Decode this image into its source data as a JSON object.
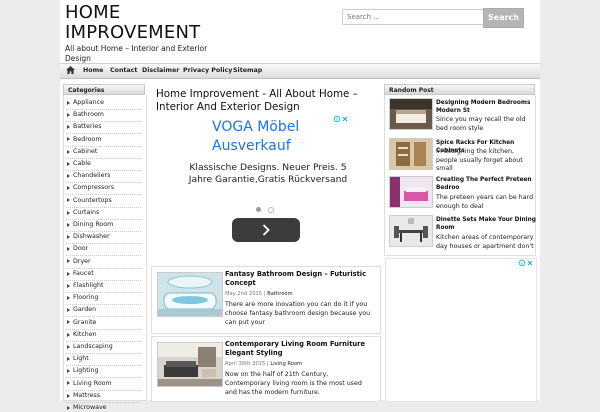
{
  "site": {
    "title_line1": "HOME",
    "title_line2": "IMPROVEMENT",
    "tagline": "All about Home – Interior and Exterior Design"
  },
  "search": {
    "placeholder": "Search ...",
    "button_label": "Search"
  },
  "nav": {
    "items": [
      "Home",
      "Contact",
      "Disclaimer",
      "Privacy Policy",
      "Sitemap"
    ]
  },
  "categories": {
    "heading": "Categories",
    "items": [
      "Appliance",
      "Bathroom",
      "Batteries",
      "Bedroom",
      "Cabinet",
      "Cable",
      "Chandeliers",
      "Compressors",
      "Countertops",
      "Curtains",
      "Dining Room",
      "Dishwasher",
      "Door",
      "Dryer",
      "Faucet",
      "Flashlight",
      "Flooring",
      "Garden",
      "Granite",
      "Kitchen",
      "Landscaping",
      "Light",
      "Lighting",
      "Living Room",
      "Mattress",
      "Microwave"
    ]
  },
  "main": {
    "title": "Home Improvement - All About Home – Interior And Exterior Design"
  },
  "ad": {
    "title": "VOGA Möbel Ausverkauf",
    "text": "Klassische Designs. Neuer Preis. 5 Jahre Garantie,Gratis Rückversand"
  },
  "posts": [
    {
      "title": "Fantasy Bathroom Design – Futuristic Concept",
      "date": "May 2nd 2015",
      "category": "Bathroom",
      "excerpt": "There are more inovation you can do it if you choose fantasy bathroom design because you can put your"
    },
    {
      "title": "Contemporary Living Room Furniture Elegant Styling",
      "date": "April 30th 2015",
      "category": "Living Room",
      "excerpt": "Now on the half of 21th Century, Contemporary living room is the most used and has the modern furniture."
    }
  ],
  "random_posts": {
    "heading": "Random Post",
    "items": [
      {
        "title": "Designing Modern Bedrooms Modern St",
        "excerpt": "Since you may recall the old bed room style"
      },
      {
        "title": "Spice Racks For Kitchen Cabinets",
        "excerpt": "In designing the kitchen, people usually forget about small"
      },
      {
        "title": "Creating The Perfect Preteen Bedroo",
        "excerpt": "The preteen years can be hard enough to deal"
      },
      {
        "title": "Dinette Sets Make Your Dining Room",
        "excerpt": "Kitchen areas of contemporary day houses or apartment don't"
      }
    ]
  },
  "colors": {
    "ad_title": "#1a73e8",
    "ad_button": "#3c3c3c",
    "search_button": "#b5b5b5",
    "page_bg": "#ececec"
  }
}
